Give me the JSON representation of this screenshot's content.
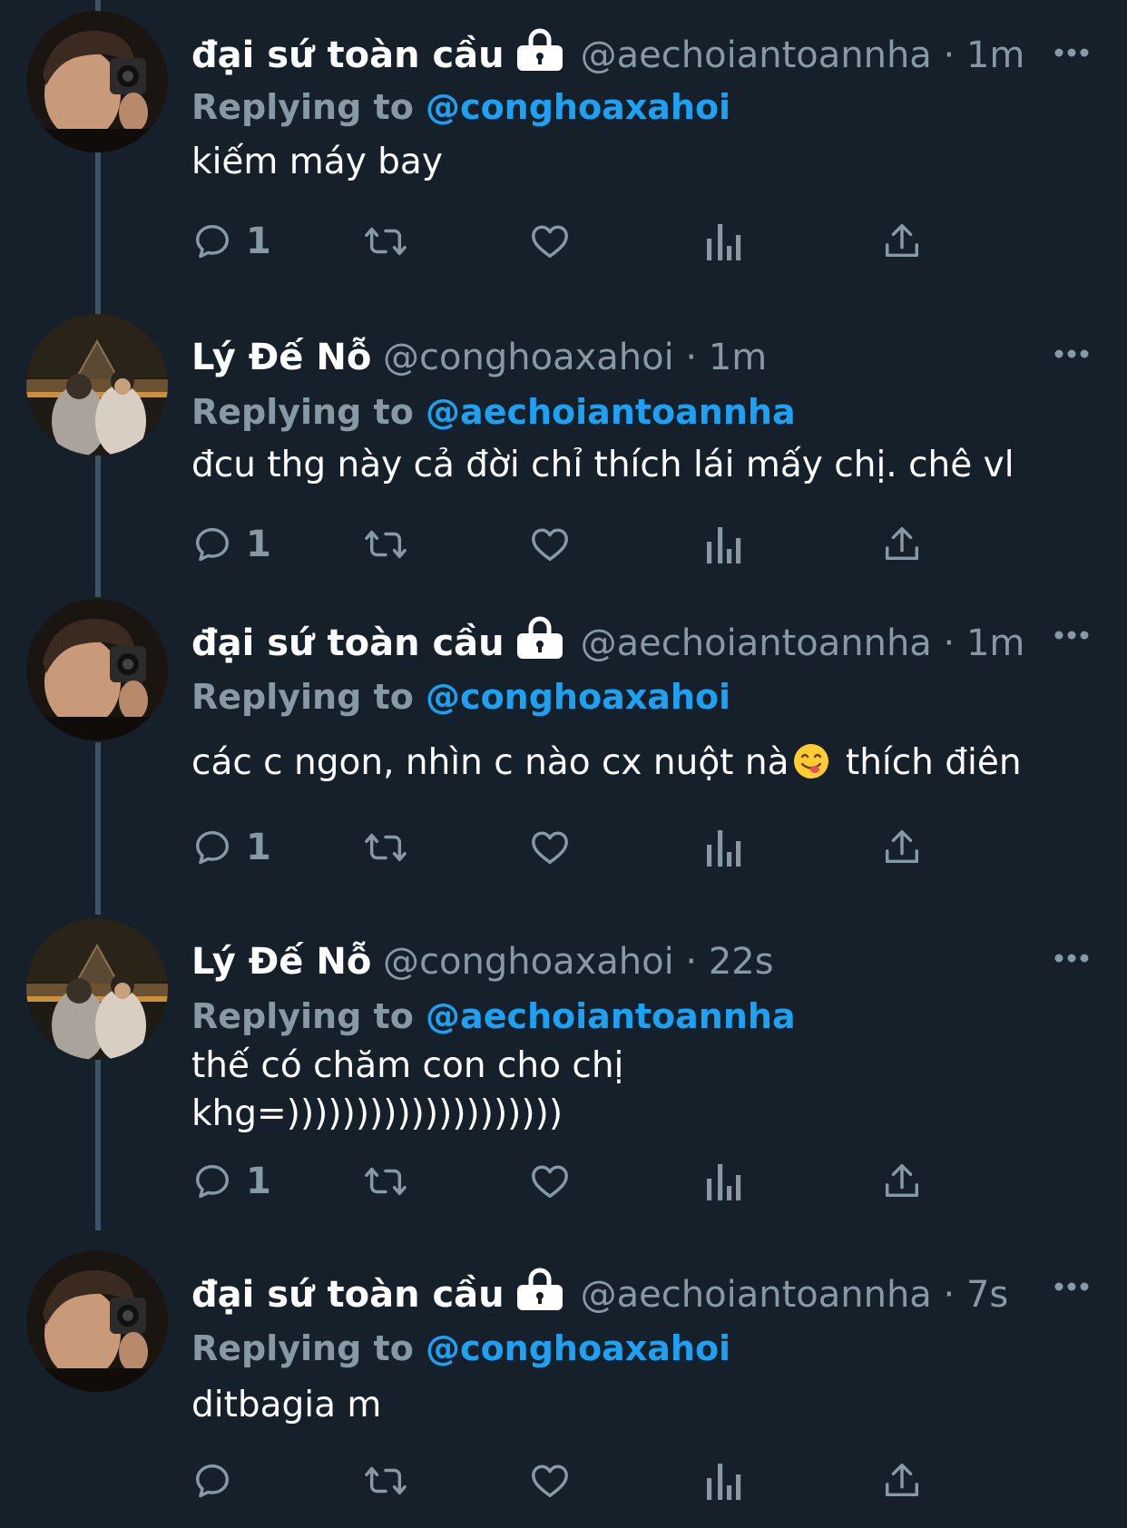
{
  "tweets": [
    {
      "display_name": "đại sứ toàn cầu",
      "handle": "@aechoiantoannha",
      "dot": "·",
      "time": "1m",
      "replying_prefix": "Replying to",
      "replying_to": "@conghoaxahoi",
      "text": "kiếm máy bay",
      "reply_count": "1",
      "protected": true,
      "avatar": "user-aechoiantoannha"
    },
    {
      "display_name": "Lý Đế Nỗ",
      "handle": "@conghoaxahoi",
      "dot": "·",
      "time": "1m",
      "replying_prefix": "Replying to",
      "replying_to": "@aechoiantoannha",
      "text": "đcu thg này cả đời chỉ thích lái mấy chị. chê vl",
      "reply_count": "1",
      "protected": false,
      "avatar": "user-conghoaxahoi"
    },
    {
      "display_name": "đại sứ toàn cầu",
      "handle": "@aechoiantoannha",
      "dot": "·",
      "time": "1m",
      "replying_prefix": "Replying to",
      "replying_to": "@conghoaxahoi",
      "text_before_emoji": "các c ngon, nhìn c nào cx nuột nà",
      "emoji": "face-savoring-food",
      "text_after_emoji": " thích điên",
      "reply_count": "1",
      "protected": true,
      "avatar": "user-aechoiantoannha"
    },
    {
      "display_name": "Lý Đế Nỗ",
      "handle": "@conghoaxahoi",
      "dot": "·",
      "time": "22s",
      "replying_prefix": "Replying to",
      "replying_to": "@aechoiantoannha",
      "text": "thế có chăm con cho chị\nkhg=))))))))))))))))))))",
      "reply_count": "1",
      "protected": false,
      "avatar": "user-conghoaxahoi"
    },
    {
      "display_name": "đại sứ toàn cầu",
      "handle": "@aechoiantoannha",
      "dot": "·",
      "time": "7s",
      "replying_prefix": "Replying to",
      "replying_to": "@conghoaxahoi",
      "text": "ditbagia m",
      "reply_count": "",
      "protected": true,
      "avatar": "user-aechoiantoannha"
    }
  ],
  "icons": {
    "reply": "reply-icon",
    "retweet": "retweet-icon",
    "like": "heart-icon",
    "analytics": "analytics-icon",
    "share": "share-icon",
    "more": "more-icon",
    "lock": "lock-icon"
  },
  "colors": {
    "background": "#15202b",
    "text": "#ffffff",
    "muted": "#8899a6",
    "link": "#1da1f2",
    "thread_line": "#3d5466"
  }
}
